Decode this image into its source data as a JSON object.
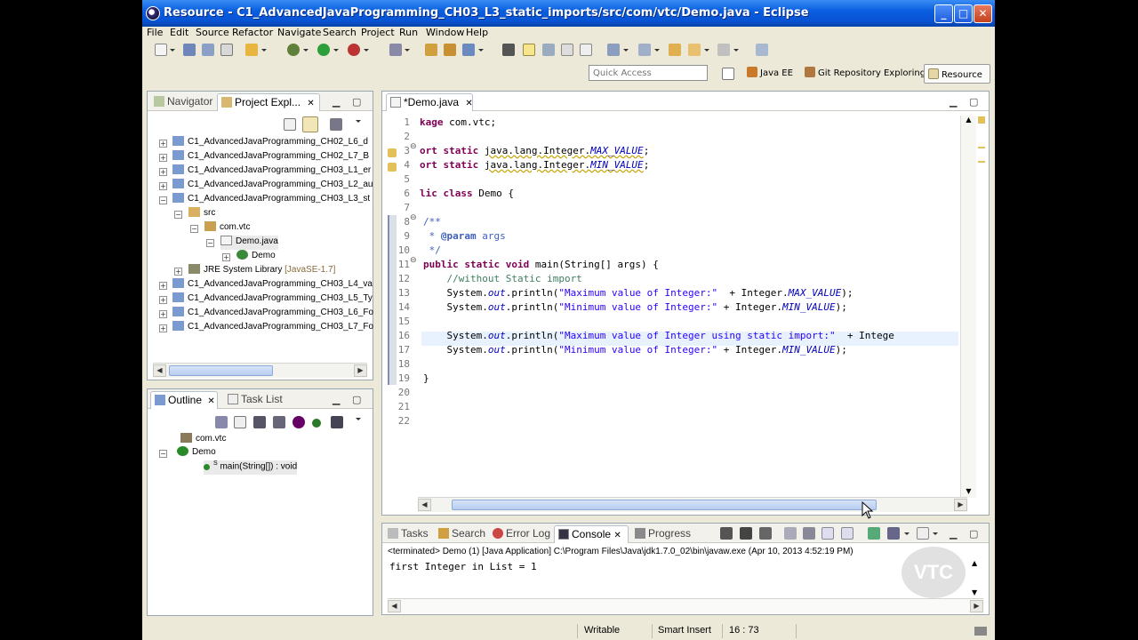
{
  "window": {
    "title": "Resource - C1_AdvancedJavaProgramming_CH03_L3_static_imports/src/com/vtc/Demo.java - Eclipse",
    "minimize": "_",
    "maximize": "□",
    "close": "✕"
  },
  "menu": [
    "File",
    "Edit",
    "Source",
    "Refactor",
    "Navigate",
    "Search",
    "Project",
    "Run",
    "Window",
    "Help"
  ],
  "quick_access": {
    "placeholder": "Quick Access"
  },
  "perspectives": {
    "java_ee": "Java EE",
    "git": "Git Repository Exploring",
    "resource": "Resource"
  },
  "navigator": {
    "tabs": [
      "Navigator",
      "Project Expl..."
    ],
    "close": "✕",
    "items": [
      "C1_AdvancedJavaProgramming_CH02_L6_d",
      "C1_AdvancedJavaProgramming_CH02_L7_B",
      "C1_AdvancedJavaProgramming_CH03_L1_er",
      "C1_AdvancedJavaProgramming_CH03_L2_au",
      "C1_AdvancedJavaProgramming_CH03_L3_st",
      "src",
      "com.vtc",
      "Demo.java",
      "Demo",
      "JRE System Library",
      "C1_AdvancedJavaProgramming_CH03_L4_va",
      "C1_AdvancedJavaProgramming_CH03_L5_Ty",
      "C1_AdvancedJavaProgramming_CH03_L6_Fo",
      "C1_AdvancedJavaProgramming_CH03_L7_Fo"
    ],
    "jre_version": "[JavaSE-1.7]"
  },
  "outline": {
    "tabs": [
      "Outline",
      "Task List"
    ],
    "items": [
      "com.vtc",
      "Demo",
      "main(String[]) : void"
    ],
    "static_marker": "S"
  },
  "editor": {
    "tab": "*Demo.java",
    "lines": [
      {
        "n": "1",
        "text": "kage com.vtc;"
      },
      {
        "n": "2",
        "text": ""
      },
      {
        "n": "3",
        "text": "ort static java.lang.Integer.MAX_VALUE;"
      },
      {
        "n": "4",
        "text": "ort static java.lang.Integer.MIN_VALUE;"
      },
      {
        "n": "5",
        "text": ""
      },
      {
        "n": "6",
        "text": "lic class Demo {"
      },
      {
        "n": "7",
        "text": ""
      },
      {
        "n": "8",
        "text": "/**"
      },
      {
        "n": "9",
        "text": " * @param args"
      },
      {
        "n": "10",
        "text": " */"
      },
      {
        "n": "11",
        "text": "public static void main(String[] args) {"
      },
      {
        "n": "12",
        "text": "    //without Static import"
      },
      {
        "n": "13",
        "text": "    System.out.println(\"Maximum value of Integer:\"  + Integer.MAX_VALUE);"
      },
      {
        "n": "14",
        "text": "    System.out.println(\"Minimum value of Integer:\" + Integer.MIN_VALUE);"
      },
      {
        "n": "15",
        "text": ""
      },
      {
        "n": "16",
        "text": "    System.out.println(\"Maximum value of Integer using static import:\"  + Intege"
      },
      {
        "n": "17",
        "text": "    System.out.println(\"Minimum value of Integer:\" + Integer.MIN_VALUE);"
      },
      {
        "n": "18",
        "text": ""
      },
      {
        "n": "19",
        "text": "}"
      },
      {
        "n": "20",
        "text": ""
      },
      {
        "n": "21",
        "text": ""
      },
      {
        "n": "22",
        "text": ""
      }
    ]
  },
  "console": {
    "tabs": [
      "Tasks",
      "Search",
      "Error Log",
      "Console",
      "Progress"
    ],
    "header": "<terminated> Demo (1) [Java Application] C:\\Program Files\\Java\\jdk1.7.0_02\\bin\\javaw.exe (Apr 10, 2013 4:52:19 PM)",
    "output": "first Integer in List = 1"
  },
  "status": {
    "writable": "Writable",
    "insert_mode": "Smart Insert",
    "position": "16 : 73"
  },
  "watermark": "VTC",
  "colors": {
    "title_bar": "#0A5FE0",
    "keyword": "#7F0055",
    "string": "#2A00FF",
    "comment": "#3F7F5F"
  }
}
